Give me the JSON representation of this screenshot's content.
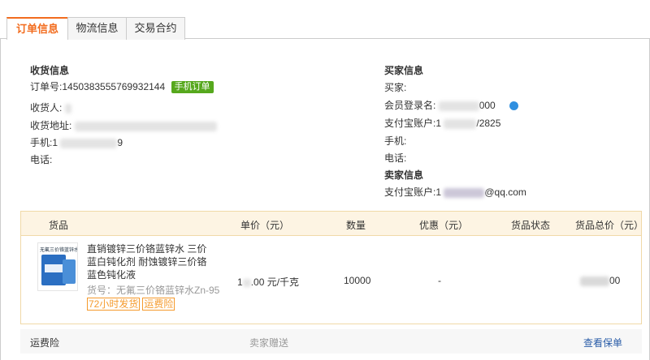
{
  "tabs": [
    {
      "label": "订单信息",
      "active": true
    },
    {
      "label": "物流信息",
      "active": false
    },
    {
      "label": "交易合约",
      "active": false
    }
  ],
  "receiver": {
    "title": "收货信息",
    "order_no_label": "订单号:",
    "order_no": "1450383555769932144",
    "mobile_badge": "手机订单",
    "name_label": "收货人:",
    "address_label": "收货地址:",
    "phone_label": "手机:",
    "phone_partial": "1",
    "phone_tail": "9",
    "tel_label": "电话:"
  },
  "buyer": {
    "title": "买家信息",
    "buyer_label": "买家:",
    "member_label": "会员登录名:",
    "member_tail": "000",
    "alipay_label": "支付宝账户:",
    "alipay_partial": "1",
    "alipay_tail": "/2825",
    "phone_label": "手机:",
    "tel_label": "电话:"
  },
  "seller": {
    "title": "卖家信息",
    "alipay_label": "支付宝账户:",
    "alipay_partial": "1",
    "alipay_tail": "@qq.com"
  },
  "goods_table": {
    "headers": [
      "货品",
      "单价（元）",
      "数量",
      "优惠（元）",
      "货品状态",
      "货品总价（元）"
    ],
    "item": {
      "thumb_caption": "无氟三价铬蓝锌水",
      "name": "直销镀锌三价铬蓝锌水 三价蓝白钝化剂 耐蚀镀锌三价铬蓝色钝化液",
      "sku": "货号：无氟三价铬蓝锌水Zn-95",
      "tags": [
        "72小时发货",
        "运费险"
      ],
      "unit_price_partial": "1",
      "unit_price_suffix": ".00 元/千克",
      "quantity": "10000",
      "discount": "-",
      "status": "",
      "total_tail": "00"
    }
  },
  "footer": {
    "insurance_label": "运费险",
    "insurance_giver": "卖家赠送",
    "view_policy": "查看保单"
  },
  "colors": {
    "accent": "#f26c1e",
    "mobile_badge": "#56a81d",
    "tag_border": "#f59a2c",
    "link": "#2a5da8"
  }
}
